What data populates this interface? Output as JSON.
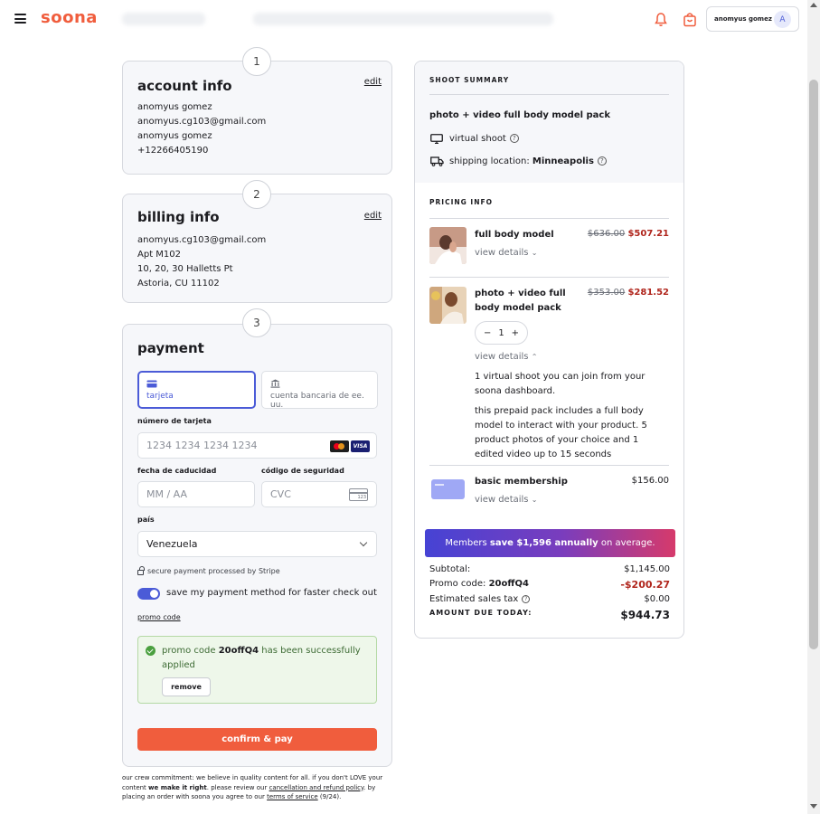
{
  "header": {
    "logo": "soona",
    "account_name": "anomyus gomez",
    "avatar_initial": "A"
  },
  "account": {
    "step": "1",
    "title": "account info",
    "edit": "edit",
    "lines": [
      "anomyus gomez",
      "anomyus.cg103@gmail.com",
      "anomyus gomez",
      "+12266405190"
    ]
  },
  "billing": {
    "step": "2",
    "title": "billing info",
    "edit": "edit",
    "lines": [
      "anomyus.cg103@gmail.com",
      "Apt M102",
      "10, 20, 30 Halletts Pt",
      "Astoria, CU 11102"
    ]
  },
  "payment": {
    "step": "3",
    "title": "payment",
    "tab_card": "tarjeta",
    "tab_bank": "cuenta bancaria de ee. uu.",
    "card_number_label": "número de tarjeta",
    "card_number_placeholder": "1234 1234 1234 1234",
    "expiry_label": "fecha de caducidad",
    "expiry_placeholder": "MM / AA",
    "cvc_label": "código de seguridad",
    "cvc_placeholder": "CVC",
    "cvc_icon_text": "123",
    "country_label": "país",
    "country_value": "Venezuela",
    "secure_text": "secure payment processed by Stripe",
    "save_method": "save my payment method for faster check out",
    "promo_link": "promo code",
    "promo_prefix": "promo code",
    "promo_code": "20offQ4",
    "promo_suffix": "has been successfully applied",
    "remove": "remove",
    "confirm": "confirm & pay",
    "visa": "VISA"
  },
  "legal": {
    "t1": "our crew commitment: we believe in quality content for all. if you don't LOVE your content",
    "t2": "we make it right",
    "t3": ". please review our",
    "link1": "cancellation and refund policy",
    "t4": ". by placing an order with soona you agree to our",
    "link2": "terms of service",
    "t5": "(9/24)."
  },
  "summary": {
    "title": "SHOOT SUMMARY",
    "pack": "photo + video full body model pack",
    "shoot_type": "virtual shoot",
    "shipping_label": "shipping location:",
    "shipping_value": "Minneapolis",
    "pricing_title": "PRICING INFO",
    "items": [
      {
        "name": "full body model",
        "old": "$636.00",
        "new": "$507.21",
        "view": "view details"
      },
      {
        "name": "photo + video full body model pack",
        "old": "$353.00",
        "new": "$281.52",
        "view": "view details",
        "qty": "1",
        "desc1": "1 virtual shoot you can join from your soona dashboard.",
        "desc2": "this prepaid pack includes a full body model to interact with your product. 5 product photos of your choice and 1 edited video up to 15 seconds"
      },
      {
        "name": "basic membership",
        "price": "$156.00",
        "view": "view details"
      }
    ],
    "banner_pre": "Members",
    "banner_bold": "save $1,596 annually",
    "banner_post": "on average.",
    "subtotal_label": "Subtotal:",
    "subtotal": "$1,145.00",
    "promo_label": "Promo code:",
    "promo_code": "20offQ4",
    "promo_value": "-$200.27",
    "tax_label": "Estimated sales tax",
    "tax": "$0.00",
    "due_label": "AMOUNT DUE TODAY:",
    "due": "$944.73"
  },
  "colors": {
    "brand": "#f05d3d",
    "accent": "#4b5bd7",
    "sale": "#b0251c",
    "success": "#4aa03f"
  }
}
